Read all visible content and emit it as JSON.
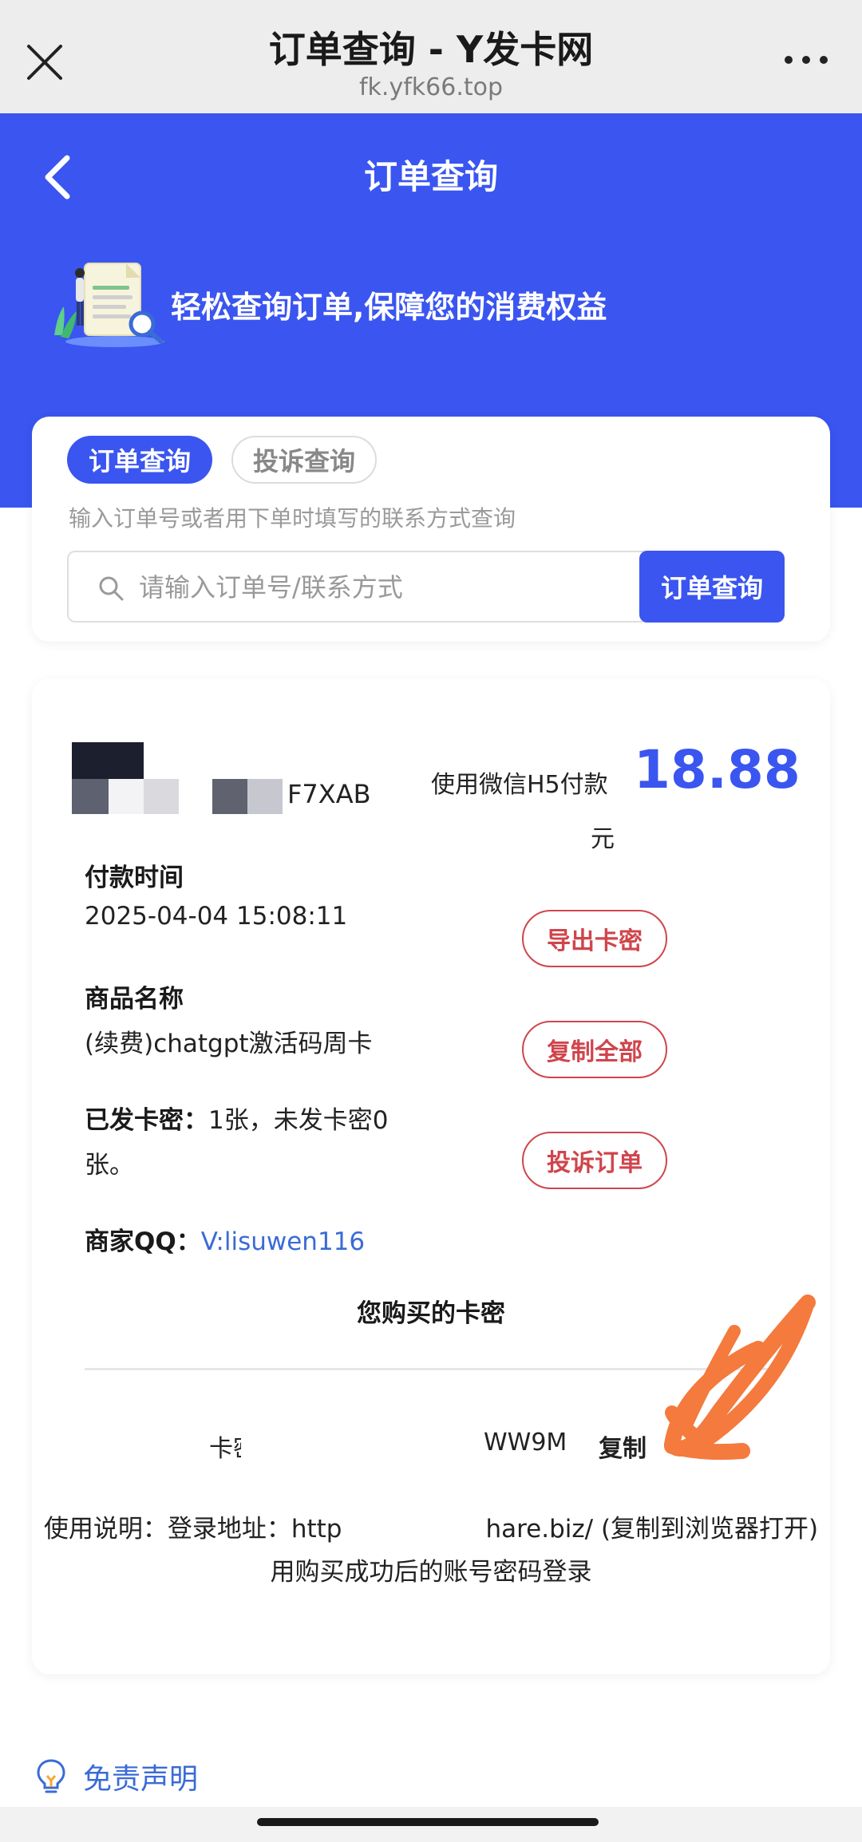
{
  "browser": {
    "title": "订单查询 - Y发卡网",
    "domain": "fk.yfk66.top"
  },
  "header": {
    "page_title": "订单查询",
    "slogan": "轻松查询订单,保障您的消费权益"
  },
  "query": {
    "tabs": [
      {
        "label": "订单查询",
        "active": true
      },
      {
        "label": "投诉查询",
        "active": false
      }
    ],
    "hint": "输入订单号或者用下单时填写的联系方式查询",
    "search_placeholder": "请输入订单号/联系方式",
    "search_button": "订单查询"
  },
  "order": {
    "order_no_tail": "F7XAB",
    "pay_method": "使用微信H5付款",
    "amount": "18.88",
    "currency": "元",
    "pay_time_label": "付款时间",
    "pay_time": "2025-04-04 15:08:11",
    "product_label": "商品名称",
    "product_name": "(续费)chatgpt激活码周卡",
    "issued_label": "已发卡密：",
    "issued_text_1": "1张，未发卡密0",
    "issued_text_2": "张。",
    "merchant_label": "商家QQ：",
    "merchant_qq": "V:lisuwen116",
    "buttons": {
      "export": "导出卡密",
      "copy_all": "复制全部",
      "complain": "投诉订单"
    }
  },
  "cards": {
    "title": "您购买的卡密",
    "label": "卡密",
    "value_tail": "WW9M",
    "copy": "复制",
    "usage_line1_a": "使用说明：登录地址：http",
    "usage_line1_b": "hare.biz/ (复制到浏览器打开)",
    "usage_line2": "用购买成功后的账号密码登录"
  },
  "footer": {
    "disclaimer": "免责声明"
  },
  "colors": {
    "primary": "#3a55f0",
    "danger": "#d0454c",
    "annotation": "#f47a3d"
  }
}
